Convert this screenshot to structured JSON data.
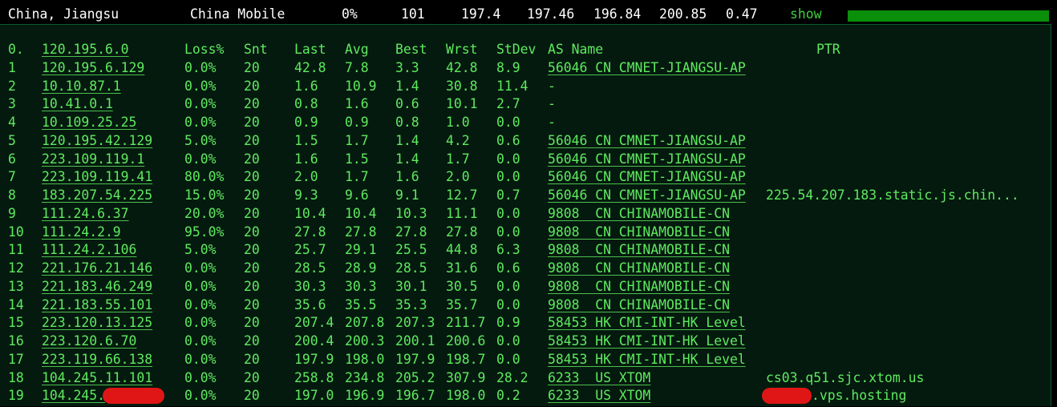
{
  "header": {
    "location": "China, Jiangsu",
    "isp": "China Mobile",
    "loss": "0%",
    "sent": "101",
    "last": "197.4",
    "avg": "197.46",
    "best": "196.84",
    "worst": "200.85",
    "stdev": "0.47",
    "show_label": "show",
    "accent_color": "#0a8f0a"
  },
  "columns": {
    "hop": "0.",
    "ip": "120.195.6.0",
    "loss": "Loss%",
    "snt": "Snt",
    "last": "Last",
    "avg": "Avg",
    "best": "Best",
    "wrst": "Wrst",
    "stdev": "StDev",
    "as": "AS Name",
    "ptr": "PTR"
  },
  "rows": [
    {
      "hop": "1",
      "ip": "120.195.6.129",
      "loss": "0.0%",
      "snt": "20",
      "last": "42.8",
      "avg": "7.8",
      "best": "3.3",
      "wrst": "42.8",
      "stdev": "8.9",
      "as": "56046 CN CMNET-JIANGSU-AP",
      "ptr": ""
    },
    {
      "hop": "2",
      "ip": "10.10.87.1",
      "loss": "0.0%",
      "snt": "20",
      "last": "1.6",
      "avg": "10.9",
      "best": "1.4",
      "wrst": "30.8",
      "stdev": "11.4",
      "as": "-",
      "ptr": ""
    },
    {
      "hop": "3",
      "ip": "10.41.0.1",
      "loss": "0.0%",
      "snt": "20",
      "last": "0.8",
      "avg": "1.6",
      "best": "0.6",
      "wrst": "10.1",
      "stdev": "2.7",
      "as": "-",
      "ptr": ""
    },
    {
      "hop": "4",
      "ip": "10.109.25.25",
      "loss": "0.0%",
      "snt": "20",
      "last": "0.9",
      "avg": "0.9",
      "best": "0.8",
      "wrst": "1.0",
      "stdev": "0.0",
      "as": "-",
      "ptr": ""
    },
    {
      "hop": "5",
      "ip": "120.195.42.129",
      "loss": "5.0%",
      "snt": "20",
      "last": "1.5",
      "avg": "1.7",
      "best": "1.4",
      "wrst": "4.2",
      "stdev": "0.6",
      "as": "56046 CN CMNET-JIANGSU-AP",
      "ptr": ""
    },
    {
      "hop": "6",
      "ip": "223.109.119.1",
      "loss": "0.0%",
      "snt": "20",
      "last": "1.6",
      "avg": "1.5",
      "best": "1.4",
      "wrst": "1.7",
      "stdev": "0.0",
      "as": "56046 CN CMNET-JIANGSU-AP",
      "ptr": ""
    },
    {
      "hop": "7",
      "ip": "223.109.119.41",
      "loss": "80.0%",
      "snt": "20",
      "last": "2.0",
      "avg": "1.7",
      "best": "1.6",
      "wrst": "2.0",
      "stdev": "0.0",
      "as": "56046 CN CMNET-JIANGSU-AP",
      "ptr": ""
    },
    {
      "hop": "8",
      "ip": "183.207.54.225",
      "loss": "15.0%",
      "snt": "20",
      "last": "9.3",
      "avg": "9.6",
      "best": "9.1",
      "wrst": "12.7",
      "stdev": "0.7",
      "as": "56046 CN CMNET-JIANGSU-AP",
      "ptr": "225.54.207.183.static.js.chin..."
    },
    {
      "hop": "9",
      "ip": "111.24.6.37",
      "loss": "20.0%",
      "snt": "20",
      "last": "10.4",
      "avg": "10.4",
      "best": "10.3",
      "wrst": "11.1",
      "stdev": "0.0",
      "as": "9808  CN CHINAMOBILE-CN",
      "ptr": ""
    },
    {
      "hop": "10",
      "ip": "111.24.2.9",
      "loss": "95.0%",
      "snt": "20",
      "last": "27.8",
      "avg": "27.8",
      "best": "27.8",
      "wrst": "27.8",
      "stdev": "0.0",
      "as": "9808  CN CHINAMOBILE-CN",
      "ptr": ""
    },
    {
      "hop": "11",
      "ip": "111.24.2.106",
      "loss": "5.0%",
      "snt": "20",
      "last": "25.7",
      "avg": "29.1",
      "best": "25.5",
      "wrst": "44.8",
      "stdev": "6.3",
      "as": "9808  CN CHINAMOBILE-CN",
      "ptr": ""
    },
    {
      "hop": "12",
      "ip": "221.176.21.146",
      "loss": "0.0%",
      "snt": "20",
      "last": "28.5",
      "avg": "28.9",
      "best": "28.5",
      "wrst": "31.6",
      "stdev": "0.6",
      "as": "9808  CN CHINAMOBILE-CN",
      "ptr": ""
    },
    {
      "hop": "13",
      "ip": "221.183.46.249",
      "loss": "0.0%",
      "snt": "20",
      "last": "30.3",
      "avg": "30.3",
      "best": "30.1",
      "wrst": "30.5",
      "stdev": "0.0",
      "as": "9808  CN CHINAMOBILE-CN",
      "ptr": ""
    },
    {
      "hop": "14",
      "ip": "221.183.55.101",
      "loss": "0.0%",
      "snt": "20",
      "last": "35.6",
      "avg": "35.5",
      "best": "35.3",
      "wrst": "35.7",
      "stdev": "0.0",
      "as": "9808  CN CHINAMOBILE-CN",
      "ptr": ""
    },
    {
      "hop": "15",
      "ip": "223.120.13.125",
      "loss": "0.0%",
      "snt": "20",
      "last": "207.4",
      "avg": "207.8",
      "best": "207.3",
      "wrst": "211.7",
      "stdev": "0.9",
      "as": "58453 HK CMI-INT-HK Level",
      "ptr": ""
    },
    {
      "hop": "16",
      "ip": "223.120.6.70",
      "loss": "0.0%",
      "snt": "20",
      "last": "200.4",
      "avg": "200.3",
      "best": "200.1",
      "wrst": "200.6",
      "stdev": "0.0",
      "as": "58453 HK CMI-INT-HK Level",
      "ptr": ""
    },
    {
      "hop": "17",
      "ip": "223.119.66.138",
      "loss": "0.0%",
      "snt": "20",
      "last": "197.9",
      "avg": "198.0",
      "best": "197.9",
      "wrst": "198.7",
      "stdev": "0.0",
      "as": "58453 HK CMI-INT-HK Level",
      "ptr": ""
    },
    {
      "hop": "18",
      "ip": "104.245.11.101",
      "loss": "0.0%",
      "snt": "20",
      "last": "258.8",
      "avg": "234.8",
      "best": "205.2",
      "wrst": "307.9",
      "stdev": "28.2",
      "as": "6233  US XTOM",
      "ptr": "cs03.q51.sjc.xtom.us"
    },
    {
      "hop": "19",
      "ip": "104.245.",
      "loss": "0.0%",
      "snt": "20",
      "last": "197.0",
      "avg": "196.9",
      "best": "196.7",
      "wrst": "198.0",
      "stdev": "0.2",
      "as": "6233  US XTOM",
      "ptr": ".vps.hosting"
    }
  ]
}
